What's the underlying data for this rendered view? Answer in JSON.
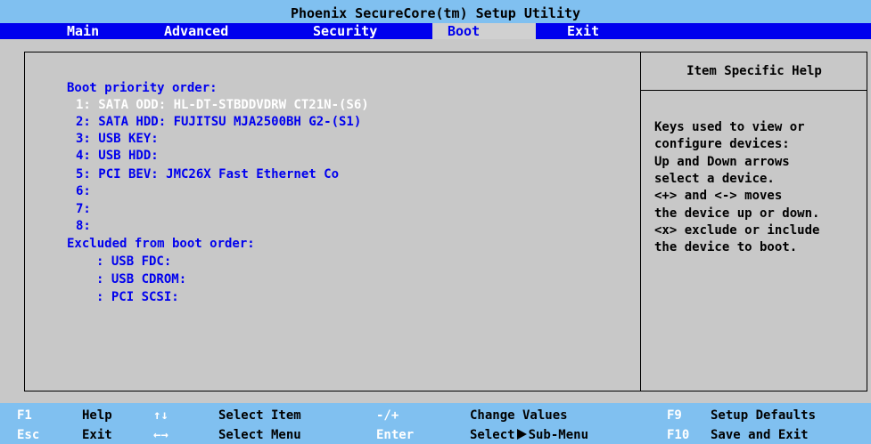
{
  "title": "Phoenix SecureCore(tm) Setup Utility",
  "menu": [
    "Main",
    "Advanced",
    "Security",
    "Boot",
    "Exit"
  ],
  "active_menu": "Boot",
  "boot": {
    "priority_heading": "Boot priority order:",
    "priority_items": [
      "1: SATA ODD: HL-DT-STBDDVDRW CT21N-(S6)",
      "2: SATA HDD: FUJITSU MJA2500BH G2-(S1)",
      "3: USB KEY:",
      "4: USB HDD:",
      "5: PCI BEV: JMC26X Fast Ethernet Co",
      "6:",
      "7:",
      "8:"
    ],
    "excluded_heading": "Excluded from boot order:",
    "excluded_items": [
      ": USB FDC:",
      ": USB CDROM:",
      ": PCI SCSI:"
    ]
  },
  "help": {
    "title": "Item Specific Help",
    "lines": [
      "Keys used to view or",
      "configure devices:",
      "Up and Down arrows",
      "select a device.",
      "<+> and <-> moves",
      "the device up or down.",
      "<x> exclude or include",
      "the device to boot."
    ]
  },
  "footer": {
    "f1": "F1",
    "f1_label": "Help",
    "updown": "↑↓",
    "updown_label": "Select Item",
    "minusplus": "-/+",
    "minusplus_label": "Change Values",
    "f9": "F9",
    "f9_label": "Setup Defaults",
    "esc": "Esc",
    "esc_label": "Exit",
    "leftright": "←→",
    "leftright_label": "Select Menu",
    "enter": "Enter",
    "enter_label_pre": "Select",
    "enter_label_post": "Sub-Menu",
    "f10": "F10",
    "f10_label": "Save and Exit"
  }
}
